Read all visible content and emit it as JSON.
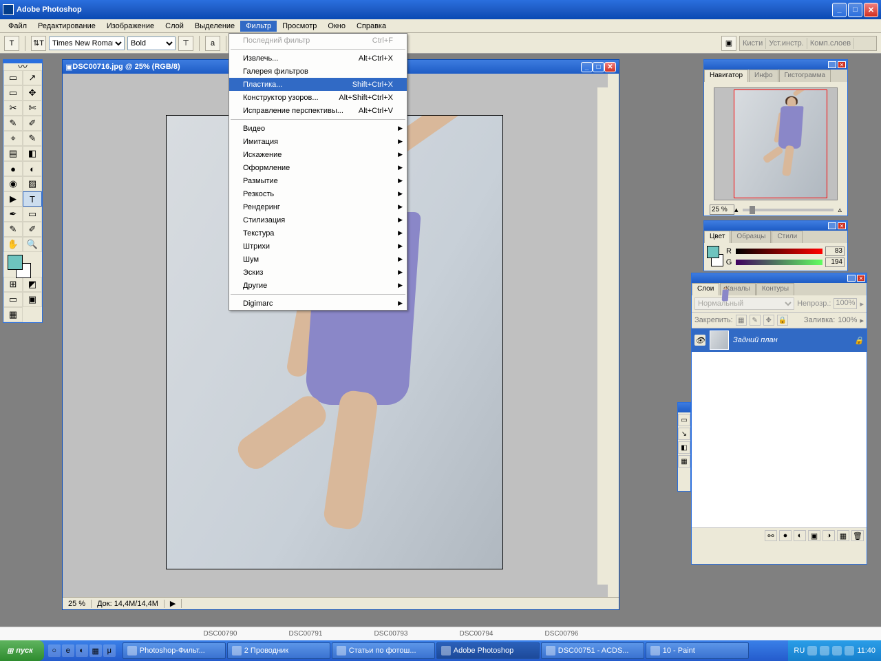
{
  "window": {
    "title": "Adobe Photoshop"
  },
  "menubar": [
    "Файл",
    "Редактирование",
    "Изображение",
    "Слой",
    "Выделение",
    "Фильтр",
    "Просмотр",
    "Окно",
    "Справка"
  ],
  "menubar_active_index": 5,
  "optbar": {
    "font": "Times New Roman",
    "weight": "Bold",
    "palette_well": [
      "Кисти",
      "Уст.инстр.",
      "Комп.слоев"
    ]
  },
  "tools": {
    "grid": [
      "▭",
      "↗",
      "▭",
      "✥",
      "✂",
      "✄",
      "✎",
      "✐",
      "⌖",
      "✎",
      "▤",
      "◧",
      "●",
      "◐",
      "◉",
      "▨",
      "▶",
      "T",
      "✒",
      "▭",
      "✎",
      "✐",
      "✋",
      "🔍"
    ],
    "active_index": 17,
    "extra": [
      "⊞",
      "◩",
      "▭",
      "▣",
      "▦"
    ]
  },
  "doc": {
    "title": "DSC00716.jpg @ 25% (RGB/8)",
    "zoom": "25 %",
    "status_doc": "Док: 14,4M/14,4M"
  },
  "filter_menu": {
    "items": [
      {
        "label": "Последний фильтр",
        "shortcut": "Ctrl+F",
        "disabled": true
      },
      {
        "sep": true
      },
      {
        "label": "Извлечь...",
        "shortcut": "Alt+Ctrl+X"
      },
      {
        "label": "Галерея фильтров"
      },
      {
        "label": "Пластика...",
        "shortcut": "Shift+Ctrl+X",
        "highlight": true
      },
      {
        "label": "Конструктор узоров...",
        "shortcut": "Alt+Shift+Ctrl+X"
      },
      {
        "label": "Исправление перспективы...",
        "shortcut": "Alt+Ctrl+V"
      },
      {
        "sep": true
      },
      {
        "label": "Видео",
        "sub": true
      },
      {
        "label": "Имитация",
        "sub": true
      },
      {
        "label": "Искажение",
        "sub": true
      },
      {
        "label": "Оформление",
        "sub": true
      },
      {
        "label": "Размытие",
        "sub": true
      },
      {
        "label": "Резкость",
        "sub": true
      },
      {
        "label": "Рендеринг",
        "sub": true
      },
      {
        "label": "Стилизация",
        "sub": true
      },
      {
        "label": "Текстура",
        "sub": true
      },
      {
        "label": "Штрихи",
        "sub": true
      },
      {
        "label": "Шум",
        "sub": true
      },
      {
        "label": "Эскиз",
        "sub": true
      },
      {
        "label": "Другие",
        "sub": true
      },
      {
        "sep": true
      },
      {
        "label": "Digimarc",
        "sub": true
      }
    ]
  },
  "navigator": {
    "tabs": [
      "Навигатор",
      "Инфо",
      "Гистограмма"
    ],
    "zoom": "25 %"
  },
  "color": {
    "tabs": [
      "Цвет",
      "Образцы",
      "Стили"
    ],
    "r_label": "R",
    "r_val": "83",
    "g_label": "G",
    "g_val": "194"
  },
  "layers": {
    "tabs": [
      "Слои",
      "Каналы",
      "Контуры"
    ],
    "blend": "Нормальный",
    "opacity_label": "Непрозр.:",
    "opacity_val": "100%",
    "lock_label": "Закрепить:",
    "fill_label": "Заливка:",
    "fill_val": "100%",
    "layer_name": "Задний план"
  },
  "explorer_files": [
    "DSC00790",
    "DSC00791",
    "DSC00793",
    "DSC00794",
    "DSC00796"
  ],
  "taskbar": {
    "start": "пуск",
    "tasks": [
      {
        "label": "Photoshop-Фильт..."
      },
      {
        "label": "2 Проводник"
      },
      {
        "label": "Статьи по фотош..."
      },
      {
        "label": "Adobe Photoshop",
        "active": true
      },
      {
        "label": "DSC00751 - ACDS..."
      },
      {
        "label": "10 - Paint"
      }
    ],
    "lang": "RU",
    "time": "11:40"
  }
}
